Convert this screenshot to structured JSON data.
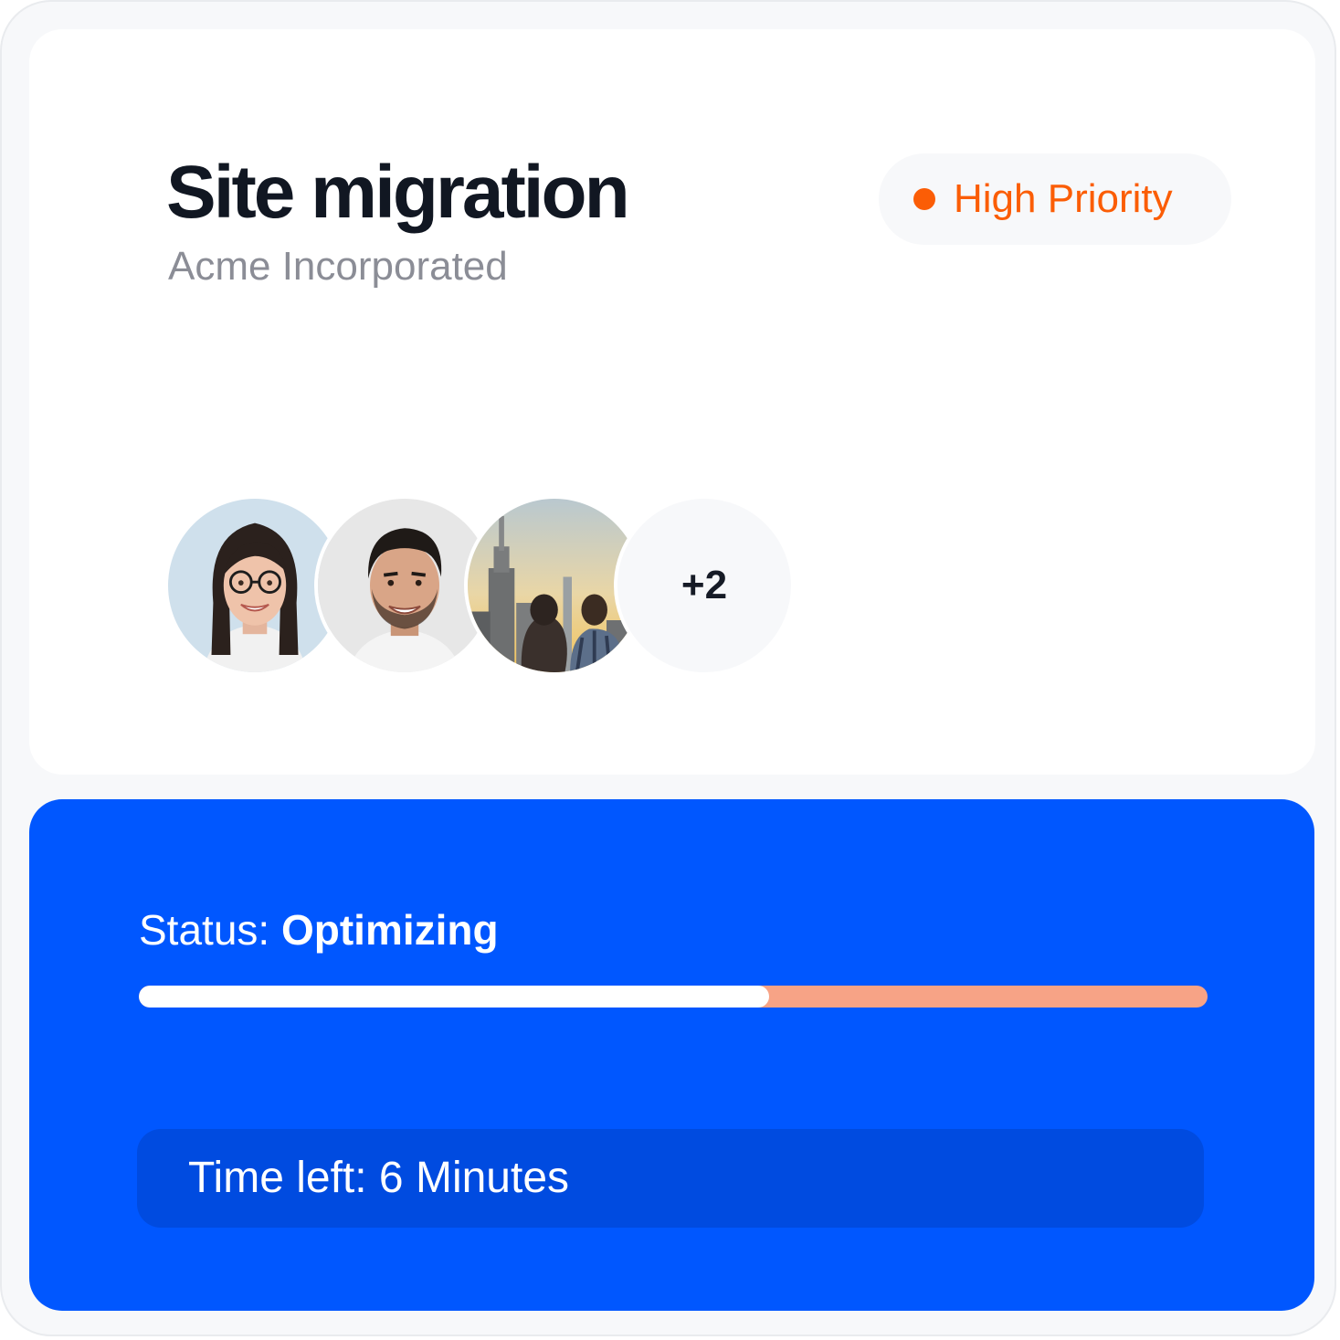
{
  "task": {
    "title": "Site migration",
    "client": "Acme Incorporated"
  },
  "priority": {
    "label": "High Priority",
    "color": "#fb5d06"
  },
  "assignees": {
    "avatars": [
      {
        "icon": "woman-with-glasses-photo"
      },
      {
        "icon": "smiling-man-photo"
      },
      {
        "icon": "people-at-city-skyline-photo"
      }
    ],
    "more_label": "+2"
  },
  "status": {
    "prefix": "Status: ",
    "value": "Optimizing",
    "progress_fraction": 0.59,
    "progress_color": "#ffffff",
    "track_color": "#f7a386",
    "panel_color": "#0057ff"
  },
  "time_left": {
    "label": "Time left: 6 Minutes"
  }
}
